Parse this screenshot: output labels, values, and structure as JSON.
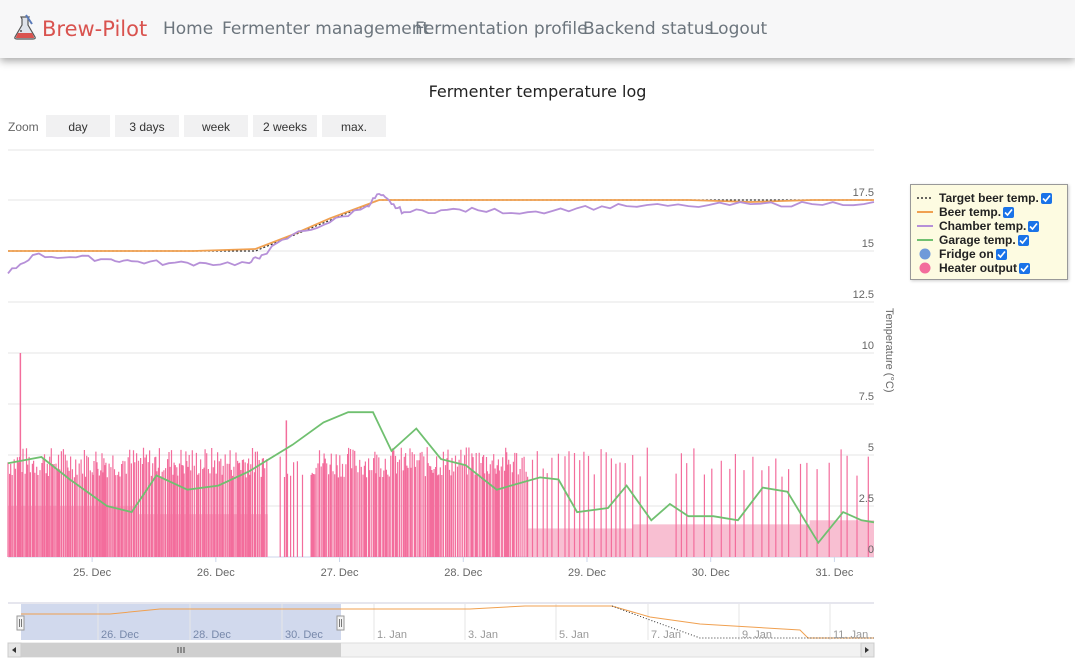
{
  "navbar": {
    "brand": "Brew-Pilot",
    "links": [
      "Home",
      "Fermenter management",
      "Fermentation profile",
      "Backend status",
      "Logout"
    ]
  },
  "chart": {
    "title": "Fermenter temperature log",
    "zoom_label": "Zoom",
    "zoom_buttons": [
      "day",
      "3 days",
      "week",
      "2 weeks",
      "max."
    ],
    "y_axis_title": "Temperature (°C)"
  },
  "legend": {
    "items": [
      {
        "label": "Target beer temp.",
        "color": "#333333",
        "style": "dotted"
      },
      {
        "label": "Beer temp.",
        "color": "#f0a050",
        "style": "line"
      },
      {
        "label": "Chamber temp.",
        "color": "#b690d8",
        "style": "line"
      },
      {
        "label": "Garage temp.",
        "color": "#70c070",
        "style": "line"
      },
      {
        "label": "Fridge on",
        "color": "#6f9ad9",
        "style": "dot"
      },
      {
        "label": "Heater output",
        "color": "#f36d9c",
        "style": "dot"
      }
    ]
  },
  "chart_data": {
    "type": "line",
    "title": "Fermenter temperature log",
    "xlabel": "",
    "ylabel": "Temperature (°C)",
    "ylim": [
      0,
      17.5
    ],
    "yticks": [
      "0",
      "2.5",
      "5",
      "7.5",
      "10",
      "12.5",
      "15",
      "17.5"
    ],
    "ytick_values": [
      0,
      2.5,
      5,
      7.5,
      10,
      12.5,
      15,
      17.5
    ],
    "xticks": [
      "25. Dec",
      "26. Dec",
      "27. Dec",
      "28. Dec",
      "29. Dec",
      "30. Dec",
      "31. Dec"
    ],
    "xtick_values": [
      0.68,
      1.68,
      2.68,
      3.68,
      4.68,
      5.68,
      6.68
    ],
    "xlim": [
      0,
      7.0
    ],
    "grid": true,
    "legend_position": "right",
    "series": [
      {
        "name": "Target beer temp.",
        "color": "#333333",
        "x": [
          0,
          2.0,
          3.0,
          7.0
        ],
        "y": [
          15.0,
          15.0,
          17.5,
          17.5
        ]
      },
      {
        "name": "Beer temp.",
        "color": "#f0a050",
        "x": [
          0,
          0.5,
          1.0,
          1.5,
          2.0,
          2.3,
          2.6,
          3.0,
          3.5,
          4.0,
          4.5,
          5.0,
          5.5,
          6.0,
          6.5,
          7.0
        ],
        "y": [
          15.0,
          15.0,
          15.0,
          15.0,
          15.1,
          15.8,
          16.6,
          17.5,
          17.5,
          17.5,
          17.5,
          17.5,
          17.5,
          17.4,
          17.5,
          17.5
        ]
      },
      {
        "name": "Chamber temp.",
        "color": "#b690d8",
        "x": [
          0,
          0.2,
          0.5,
          0.8,
          1.0,
          1.3,
          1.6,
          1.95,
          2.05,
          2.3,
          2.6,
          2.9,
          3.0,
          3.1,
          3.2,
          3.5,
          3.8,
          4.2,
          4.6,
          5.0,
          5.5,
          6.0,
          6.5,
          7.0
        ],
        "y": [
          13.9,
          14.8,
          14.7,
          14.6,
          14.5,
          14.4,
          14.4,
          14.4,
          14.8,
          15.8,
          16.4,
          17.2,
          17.8,
          17.3,
          16.9,
          17.0,
          17.0,
          16.9,
          17.1,
          17.2,
          17.2,
          17.3,
          17.3,
          17.4
        ]
      },
      {
        "name": "Garage temp.",
        "color": "#70c070",
        "x": [
          0,
          0.27,
          0.5,
          0.8,
          1.0,
          1.2,
          1.45,
          1.7,
          1.95,
          2.3,
          2.55,
          2.75,
          2.95,
          3.1,
          3.3,
          3.5,
          3.7,
          3.95,
          4.3,
          4.45,
          4.6,
          4.85,
          5.0,
          5.2,
          5.35,
          5.5,
          5.7,
          5.9,
          6.1,
          6.3,
          6.55,
          6.75,
          6.9,
          7.0
        ],
        "y": [
          4.6,
          4.9,
          3.8,
          2.5,
          2.2,
          4.0,
          3.3,
          3.5,
          4.2,
          5.5,
          6.6,
          7.1,
          7.1,
          5.2,
          6.3,
          4.8,
          4.5,
          3.3,
          3.9,
          3.8,
          2.2,
          2.4,
          3.5,
          1.8,
          2.6,
          2.0,
          2.0,
          1.8,
          3.4,
          3.2,
          0.7,
          2.2,
          1.8,
          1.7
        ]
      }
    ],
    "heater_output": {
      "name": "Heater output",
      "color": "#f36d9c",
      "segments": [
        {
          "x_start": 0.0,
          "x_end": 1.05,
          "level": 2.5
        },
        {
          "x_start": 1.05,
          "x_end": 2.1,
          "level": 2.1
        },
        {
          "x_start": 2.1,
          "x_end": 4.2,
          "level": 0.0
        },
        {
          "x_start": 4.2,
          "x_end": 5.05,
          "level": 1.4
        },
        {
          "x_start": 5.05,
          "x_end": 6.48,
          "level": 1.6
        },
        {
          "x_start": 6.48,
          "x_end": 7.0,
          "level": 1.8
        }
      ],
      "peak": 10.0
    }
  },
  "navigator": {
    "labels": [
      "26. Dec",
      "28. Dec",
      "30. Dec",
      "1. Jan",
      "3. Jan",
      "5. Jan",
      "7. Jan",
      "9. Jan",
      "11. Jan"
    ]
  }
}
